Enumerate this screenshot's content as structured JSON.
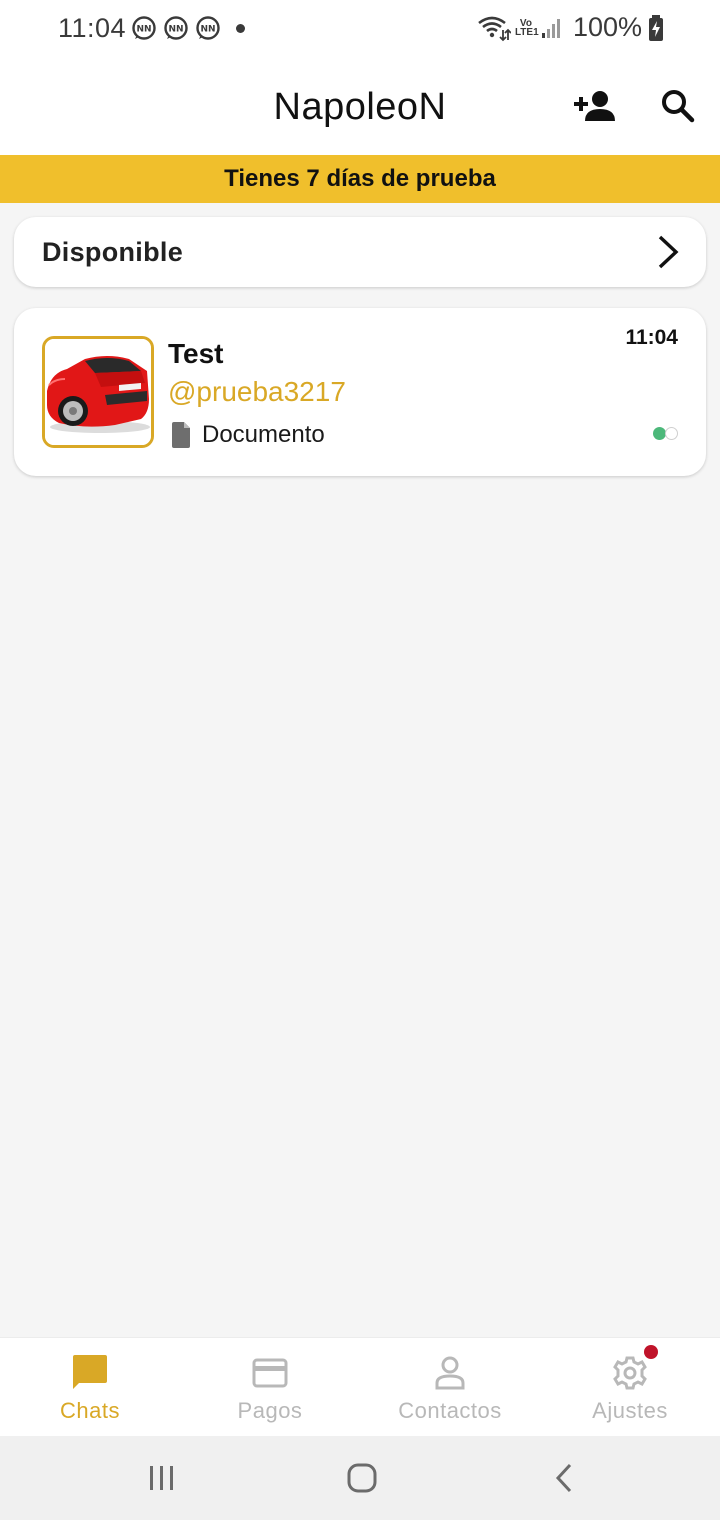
{
  "status_bar": {
    "time": "11:04",
    "notification_icons": [
      "napoleon-notification-icon",
      "napoleon-notification-icon",
      "napoleon-notification-icon"
    ],
    "network_label": "Vo\nLTE1",
    "battery": "100%"
  },
  "app_bar": {
    "title": "NapoleoN",
    "add_contact_icon": "add-person-icon",
    "search_icon": "search-icon"
  },
  "trial_banner": {
    "text": "Tienes 7 días de prueba"
  },
  "availability": {
    "label": "Disponible",
    "icon": "chevron-right-icon"
  },
  "chats": [
    {
      "name": "Test",
      "handle": "@prueba3217",
      "preview_icon": "document-icon",
      "preview": "Documento",
      "time": "11:04",
      "avatar": "red-car-photo"
    }
  ],
  "bottom_nav": {
    "items": [
      {
        "label": "Chats",
        "icon": "chat-icon",
        "active": true
      },
      {
        "label": "Pagos",
        "icon": "card-icon",
        "active": false
      },
      {
        "label": "Contactos",
        "icon": "person-icon",
        "active": false
      },
      {
        "label": "Ajustes",
        "icon": "gear-icon",
        "active": false,
        "badge": true
      }
    ]
  },
  "colors": {
    "accent": "#d9a826",
    "banner": "#f0bf2c",
    "online": "#4cb87a",
    "badge": "#c0132a",
    "inactive": "#b8b8b8"
  }
}
